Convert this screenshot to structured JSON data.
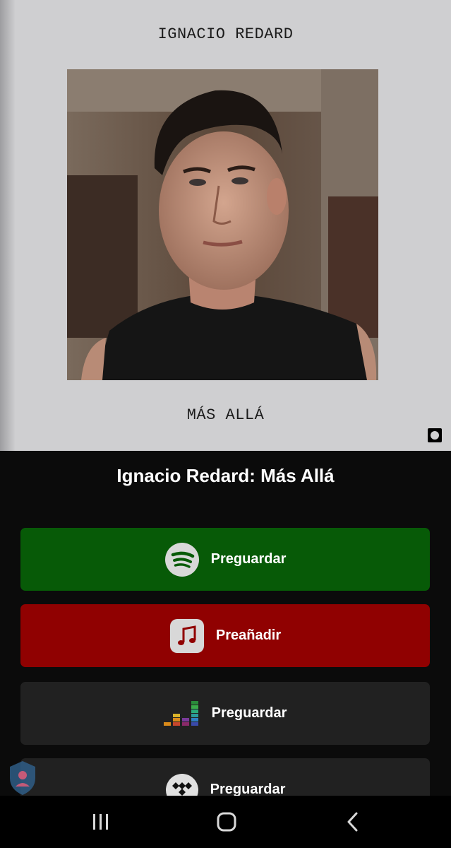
{
  "artwork": {
    "artist_text": "IGNACIO REDARD",
    "album_text": "MÁS ALLÁ",
    "photo_icon": "artist-portrait-image",
    "corner_icon": "circle-badge-icon"
  },
  "release": {
    "title": "Ignacio Redard: Más Allá"
  },
  "services": [
    {
      "name": "spotify",
      "label": "Preguardar",
      "color": "#075a07",
      "icon": "spotify-icon"
    },
    {
      "name": "apple-music",
      "label": "Preañadir",
      "color": "#900101",
      "icon": "apple-music-icon"
    },
    {
      "name": "deezer",
      "label": "Preguardar",
      "color": "#212121",
      "icon": "deezer-icon"
    },
    {
      "name": "tidal",
      "label": "Preguardar",
      "color": "#212121",
      "icon": "tidal-icon"
    }
  ],
  "navbar": {
    "recents_icon": "recent-apps-icon",
    "home_icon": "home-icon",
    "back_icon": "back-icon"
  }
}
